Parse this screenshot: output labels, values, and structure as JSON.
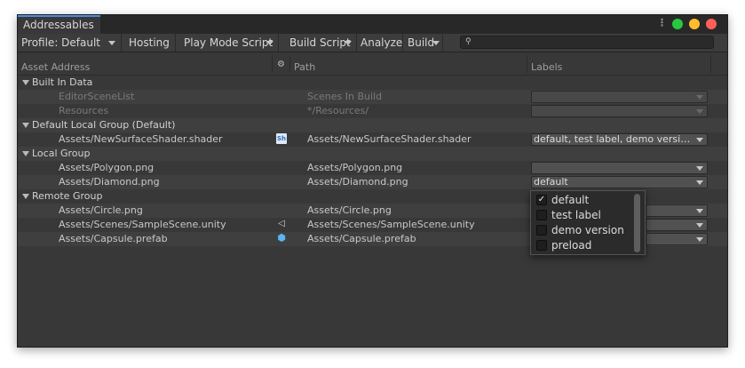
{
  "window": {
    "tab_title": "Addressables",
    "menu_glyph": "⋮"
  },
  "toolbar": {
    "profile_label": "Profile: Default",
    "hosting_label": "Hosting",
    "play_mode_label": "Play Mode Script",
    "build_script_label": "Build Script",
    "analyze_label": "Analyze",
    "build_label": "Build",
    "search_placeholder": ""
  },
  "columns": {
    "asset_address": "Asset Address",
    "path": "Path",
    "labels": "Labels"
  },
  "groups": [
    {
      "name": "Built In Data",
      "entries": [
        {
          "address": "EditorSceneList",
          "path": "Scenes In Build",
          "labels": "",
          "disabled": true,
          "icon": ""
        },
        {
          "address": "Resources",
          "path": "*/Resources/",
          "labels": "",
          "disabled": true,
          "icon": ""
        }
      ]
    },
    {
      "name": "Default Local Group (Default)",
      "entries": [
        {
          "address": "Assets/NewSurfaceShader.shader",
          "path": "Assets/NewSurfaceShader.shader",
          "labels": "default, test label, demo version...",
          "disabled": false,
          "icon": "shader-icon"
        }
      ]
    },
    {
      "name": "Local Group",
      "entries": [
        {
          "address": "Assets/Polygon.png",
          "path": "Assets/Polygon.png",
          "labels": "",
          "disabled": false,
          "icon": ""
        },
        {
          "address": "Assets/Diamond.png",
          "path": "Assets/Diamond.png",
          "labels": "default",
          "disabled": false,
          "icon": ""
        }
      ]
    },
    {
      "name": "Remote Group",
      "entries": [
        {
          "address": "Assets/Circle.png",
          "path": "Assets/Circle.png",
          "labels": "",
          "disabled": false,
          "icon": ""
        },
        {
          "address": "Assets/Scenes/SampleScene.unity",
          "path": "Assets/Scenes/SampleScene.unity",
          "labels": "",
          "disabled": false,
          "icon": "scene-icon"
        },
        {
          "address": "Assets/Capsule.prefab",
          "path": "Assets/Capsule.prefab",
          "labels": "",
          "disabled": false,
          "icon": "prefab-icon"
        }
      ]
    }
  ],
  "labels_popup": {
    "items": [
      {
        "label": "default",
        "checked": true
      },
      {
        "label": "test label",
        "checked": false
      },
      {
        "label": "demo version",
        "checked": false
      },
      {
        "label": "preload",
        "checked": false
      }
    ]
  },
  "icons": {
    "shader": "Sh",
    "scene": "◁",
    "prefab": "⬢",
    "check": "✓",
    "search": "⚲",
    "settings": "⚙"
  },
  "colors": {
    "accent": "#4d8ce6",
    "traffic_green": "#27c93f",
    "traffic_yellow": "#ffbd2e",
    "traffic_red": "#ff5f56"
  }
}
